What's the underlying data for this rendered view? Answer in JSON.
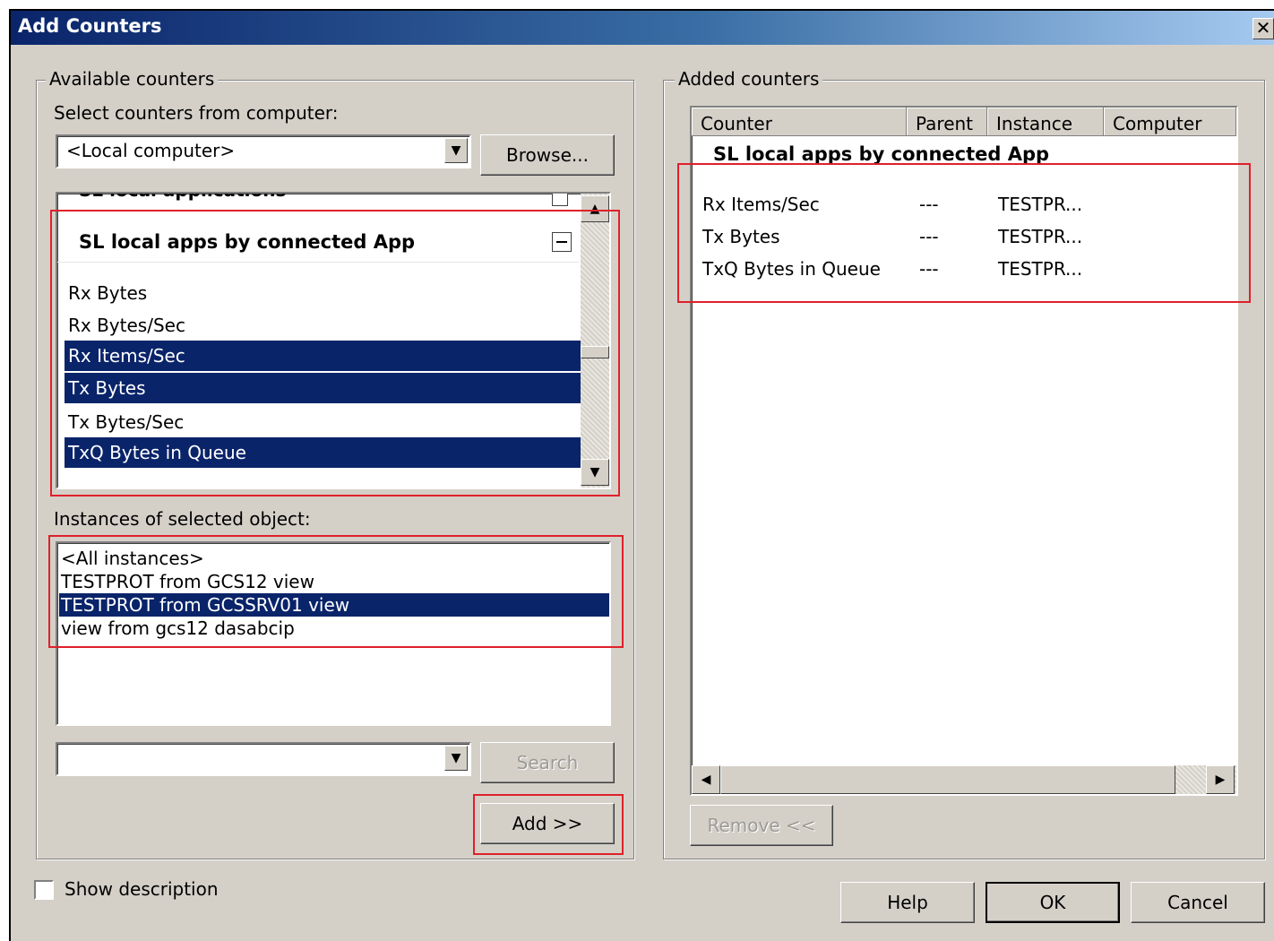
{
  "window": {
    "title": "Add Counters",
    "close_glyph": "✕"
  },
  "available": {
    "legend": "Available counters",
    "computer_label": "Select counters from computer:",
    "computer_value": "<Local computer>",
    "browse_label": "Browse...",
    "partial_header": "SL local applications",
    "object_header": "SL local apps by connected App",
    "counters": [
      {
        "label": "Rx Bytes",
        "selected": false
      },
      {
        "label": "Rx Bytes/Sec",
        "selected": false
      },
      {
        "label": "Rx Items/Sec",
        "selected": true
      },
      {
        "label": "Tx Bytes",
        "selected": true
      },
      {
        "label": "Tx Bytes/Sec",
        "selected": false
      },
      {
        "label": "TxQ Bytes in Queue",
        "selected": true
      }
    ],
    "instances_label": "Instances of selected object:",
    "instances": [
      {
        "label": "<All instances>",
        "selected": false
      },
      {
        "label": "TESTPROT from GCS12 view",
        "selected": false
      },
      {
        "label": "TESTPROT from GCSSRV01 view",
        "selected": true
      },
      {
        "label": "view from gcs12 dasabcip",
        "selected": false
      }
    ],
    "search_value": "",
    "search_label": "Search",
    "add_label": "Add >>"
  },
  "added": {
    "legend": "Added counters",
    "columns": [
      "Counter",
      "Parent",
      "Instance",
      "Computer"
    ],
    "group_header": "SL local apps by connected App",
    "rows": [
      {
        "counter": "Rx Items/Sec",
        "parent": "---",
        "instance": "TESTPR..."
      },
      {
        "counter": "Tx Bytes",
        "parent": "---",
        "instance": "TESTPR..."
      },
      {
        "counter": "TxQ Bytes in Queue",
        "parent": "---",
        "instance": "TESTPR..."
      }
    ],
    "remove_label": "Remove <<"
  },
  "footer": {
    "show_description_label": "Show description",
    "show_description_checked": false,
    "help_label": "Help",
    "ok_label": "OK",
    "cancel_label": "Cancel"
  },
  "colors": {
    "selection": "#0a246a",
    "annotation": "#e0202a",
    "dialog_bg": "#d4d0c8"
  }
}
